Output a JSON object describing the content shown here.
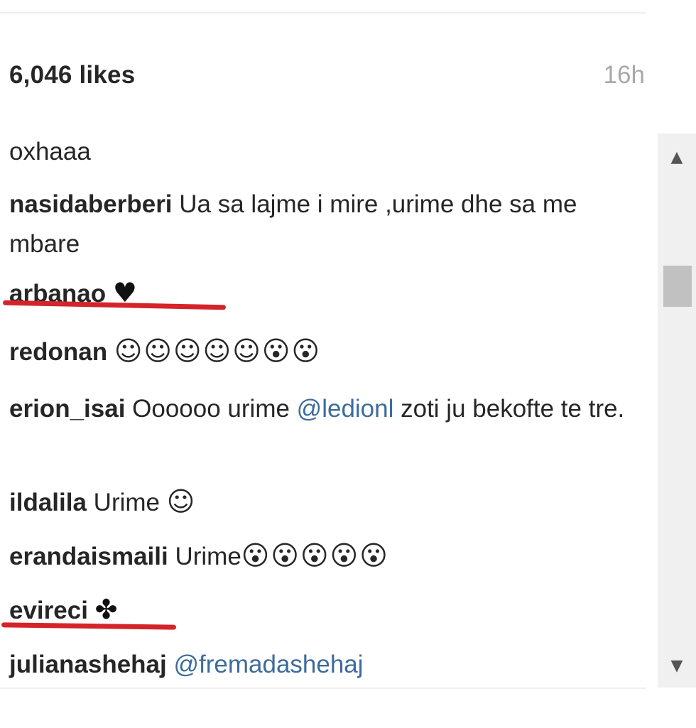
{
  "post": {
    "likes": "6,046 likes",
    "time": "16h"
  },
  "comments": [
    {
      "user": "",
      "text": "oxhaaa"
    },
    {
      "user": "nasidaberberi",
      "text": " Ua sa lajme i mire ,urime dhe sa me mbare"
    },
    {
      "user": "arbanao",
      "text": " ",
      "emoji": "♥"
    },
    {
      "user": "redonan",
      "text": " ",
      "emoji": "☺☺☺☺☺😮😮"
    },
    {
      "user": "erion_isai",
      "text": " Oooooo urime ",
      "mention": "@ledionl",
      "text_after": " zoti ju bekofte te tre."
    },
    {
      "user": "ildalila",
      "text": " Urime ",
      "emoji": "☺"
    },
    {
      "user": "erandaismaili",
      "text": " Urime",
      "emoji": "😮😮😮😮😮"
    },
    {
      "user": "evireci",
      "text": " ",
      "emoji": "✤"
    },
    {
      "user": "julianashehaj",
      "text": " ",
      "mention": "@fremadashehaj"
    }
  ],
  "annotation_color": "#d4242a",
  "scrollbar": {
    "up_icon": "scroll-up-arrow",
    "down_icon": "scroll-down-arrow"
  }
}
